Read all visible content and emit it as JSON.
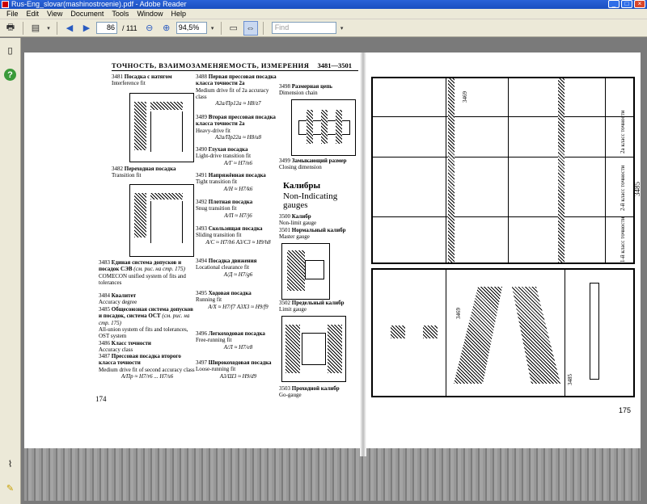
{
  "window": {
    "title": "Rus-Eng_slovar(mashinostroenie).pdf - Adobe Reader"
  },
  "menu": [
    "File",
    "Edit",
    "View",
    "Document",
    "Tools",
    "Window",
    "Help"
  ],
  "toolbar": {
    "page_current": "86",
    "page_total": "/ 111",
    "zoom": "94,5%",
    "find_placeholder": "Find"
  },
  "document": {
    "header_ru": "ТОЧНОСТЬ, ВЗАИМОЗАМЕНЯЕМОСТЬ, ИЗМЕРЕНИЯ",
    "header_range": "3481—3501",
    "entries": [
      {
        "num": "3481",
        "ru": "Посадка с натягом",
        "en": "Interference fit"
      },
      {
        "num": "3482",
        "ru": "Переходная посадка",
        "en": "Transition fit"
      },
      {
        "num": "3483",
        "ru": "Единая система допусков и посадок СЭВ",
        "en": "COMECON unified system of fits and tolerances",
        "note": "(см. рис. на стр. 175)"
      },
      {
        "num": "3484",
        "ru": "Квалитет",
        "en": "Accuracy degree"
      },
      {
        "num": "3485",
        "ru": "Общесоюзная система допусков и посадок, система ОСТ",
        "en": "All-union system of fits and tolerances, OST system",
        "note": "(см. рис. на стр. 175)"
      },
      {
        "num": "3486",
        "ru": "Класс точности",
        "en": "Accuracy class"
      },
      {
        "num": "3487",
        "ru": "Прессовая посадка второго класса точности",
        "en": "Medium drive fit of second accuracy class",
        "formula": "А/Пр ≈ H7/r6 ... H7/s6"
      },
      {
        "num": "3488",
        "ru": "Первая прессовая посадка класса точности 2а",
        "en": "Medium drive fit of 2a accuracy class",
        "formula": "А2а/Пр12а ≈ H8/z7"
      },
      {
        "num": "3489",
        "ru": "Вторая прессовая посадка класса точности 2а",
        "en": "Heavy-drive fit",
        "formula": "А2а/Пр22а ≈ H8/u8"
      },
      {
        "num": "3490",
        "ru": "Глухая посадка",
        "en": "Light-drive transition fit",
        "formula": "А/Г ≈ H7/n6"
      },
      {
        "num": "3491",
        "ru": "Напряжённая посадка",
        "en": "Tight transition fit",
        "formula": "А/Н ≈ H7/k6"
      },
      {
        "num": "3492",
        "ru": "Плотная посадка",
        "en": "Snug transition fit",
        "formula": "А/П ≈ H7/j6"
      },
      {
        "num": "3493",
        "ru": "Скользящая посадка",
        "en": "Sliding transition fit",
        "formula": "А/С ≈ H7/h6  А3/С3 ≈ H9/h8"
      },
      {
        "num": "3494",
        "ru": "Посадка движения",
        "en": "Locational clearance fit",
        "formula": "А/Д ≈ H7/g6"
      },
      {
        "num": "3495",
        "ru": "Ходовая посадка",
        "en": "Running fit",
        "formula": "А/Х ≈ H7/f7  А3Х3 ≈ H9/f9"
      },
      {
        "num": "3496",
        "ru": "Легкоходовая посадка",
        "en": "Free-running fit",
        "formula": "А/Л ≈ H7/e8"
      },
      {
        "num": "3497",
        "ru": "Широкоходовая посадка",
        "en": "Loose-running fit",
        "formula": "А3/Ш3 ≈ H9/d9"
      },
      {
        "num": "3498",
        "ru": "Размерная цепь",
        "en": "Dimension chain"
      },
      {
        "num": "3499",
        "ru": "Замыкающий размер",
        "en": "Closing dimension"
      },
      {
        "num": "3500",
        "ru": "Калибр",
        "en": "Non-limit gauge"
      },
      {
        "num": "3501",
        "ru": "Нормальный калибр",
        "en": "Master gauge"
      },
      {
        "num": "3502",
        "ru": "Предельный калибр",
        "en": "Limit gauge"
      },
      {
        "num": "3503",
        "ru": "Проходной калибр",
        "en": "Go-gauge"
      }
    ],
    "section_ru": "Калибры",
    "section_en": "Non-Indicating gauges",
    "page_left": "174",
    "page_right": "175",
    "right_labels": {
      "top_num": "3469",
      "side_num": "3485",
      "class_2a": "2а класс точности",
      "class_2": "2-й класс точности",
      "class_1": "1-й класс точности",
      "bottom_num_a": "3469",
      "bottom_num_b": "3485"
    }
  }
}
